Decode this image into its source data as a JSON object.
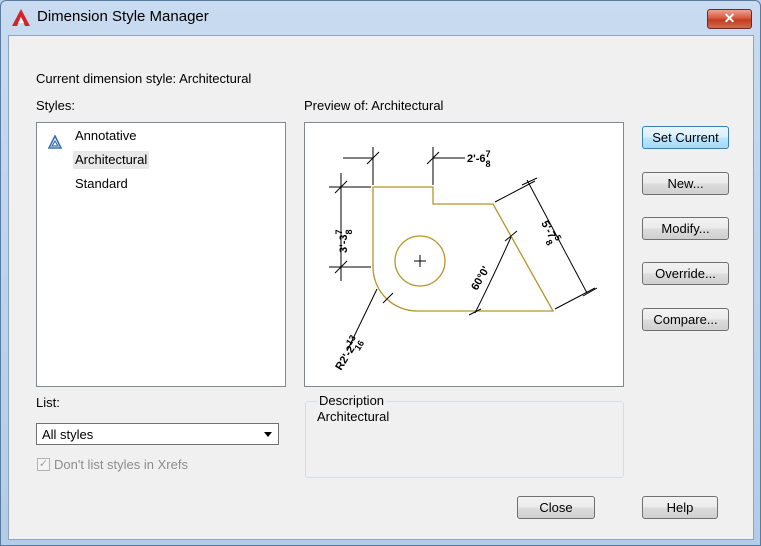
{
  "window": {
    "title": "Dimension Style Manager",
    "close_symbol": "✕"
  },
  "current_style_label": "Current dimension style: Architectural",
  "styles": {
    "label": "Styles:",
    "items": [
      {
        "name": "Annotative",
        "icon": "annotative-icon"
      },
      {
        "name": "Architectural",
        "selected": true
      },
      {
        "name": "Standard"
      }
    ]
  },
  "preview": {
    "label": "Preview of: Architectural",
    "dimensions": {
      "top_pre": "2'-6",
      "top_num": "7",
      "top_den": "8",
      "left_pre": "3'-3",
      "left_num": "7",
      "left_den": "8",
      "right_pre": "5'-7",
      "right_num": "5",
      "right_den": "8",
      "angle": "60°0'",
      "radius_pre": "R2'-2",
      "radius_num": "13",
      "radius_den": "16"
    },
    "colors": {
      "outline": "#b8942a"
    }
  },
  "description": {
    "label": "Description",
    "text": "Architectural"
  },
  "list": {
    "label": "List:",
    "selected": "All styles"
  },
  "xref_checkbox": {
    "label": "Don't list styles in Xrefs",
    "checked": true,
    "check_glyph": "✓"
  },
  "buttons": {
    "set_current": "Set Current",
    "new": "New...",
    "modify": "Modify...",
    "override": "Override...",
    "compare": "Compare...",
    "close": "Close",
    "help": "Help"
  }
}
